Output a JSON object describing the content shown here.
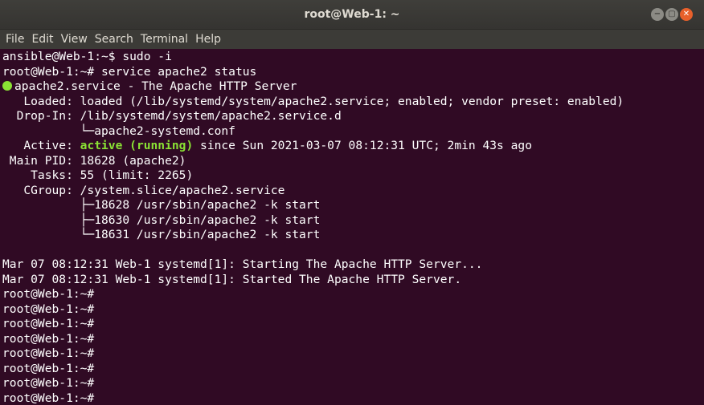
{
  "window": {
    "title": "root@Web-1: ~",
    "buttons": {
      "minimize": "−",
      "maximize": "▢",
      "close": "✕"
    }
  },
  "menu": {
    "items": [
      "File",
      "Edit",
      "View",
      "Search",
      "Terminal",
      "Help"
    ]
  },
  "terminal": {
    "lines": [
      "ansible@Web-1:~$ sudo -i",
      "root@Web-1:~# service apache2 status",
      "apache2.service - The Apache HTTP Server",
      "   Loaded: loaded (/lib/systemd/system/apache2.service; enabled; vendor preset: enabled)",
      "  Drop-In: /lib/systemd/system/apache2.service.d",
      "           └─apache2-systemd.conf",
      "   Active: ",
      " Main PID: 18628 (apache2)",
      "    Tasks: 55 (limit: 2265)",
      "   CGroup: /system.slice/apache2.service",
      "           ├─18628 /usr/sbin/apache2 -k start",
      "           ├─18630 /usr/sbin/apache2 -k start",
      "           └─18631 /usr/sbin/apache2 -k start",
      "",
      "Mar 07 08:12:31 Web-1 systemd[1]: Starting The Apache HTTP Server...",
      "Mar 07 08:12:31 Web-1 systemd[1]: Started The Apache HTTP Server.",
      "root@Web-1:~#",
      "root@Web-1:~#",
      "root@Web-1:~#",
      "root@Web-1:~#",
      "root@Web-1:~#",
      "root@Web-1:~#",
      "root@Web-1:~#",
      "root@Web-1:~#"
    ],
    "active_status": "active (running)",
    "active_rest": " since Sun 2021-03-07 08:12:31 UTC; 2min 43s ago"
  },
  "colors": {
    "background": "#300a24",
    "active_green": "#8ae234",
    "close_button": "#e8602b"
  }
}
